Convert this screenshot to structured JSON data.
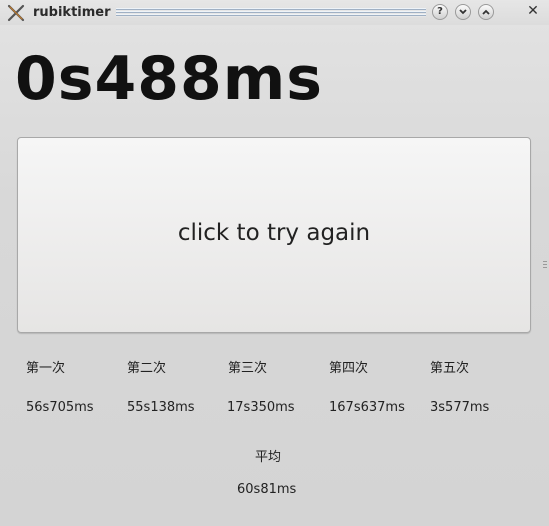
{
  "window": {
    "title": "rubiktimer",
    "help_button": "?",
    "close_button": "✕"
  },
  "timer": {
    "display": "0s488ms"
  },
  "action_button": {
    "label": "click to try again"
  },
  "attempts": [
    {
      "label": "第一次",
      "value": "56s705ms"
    },
    {
      "label": "第二次",
      "value": "55s138ms"
    },
    {
      "label": "第三次",
      "value": "17s350ms"
    },
    {
      "label": "第四次",
      "value": "167s637ms"
    },
    {
      "label": "第五次",
      "value": "3s577ms"
    }
  ],
  "average": {
    "label": "平均",
    "value": "60s81ms"
  }
}
